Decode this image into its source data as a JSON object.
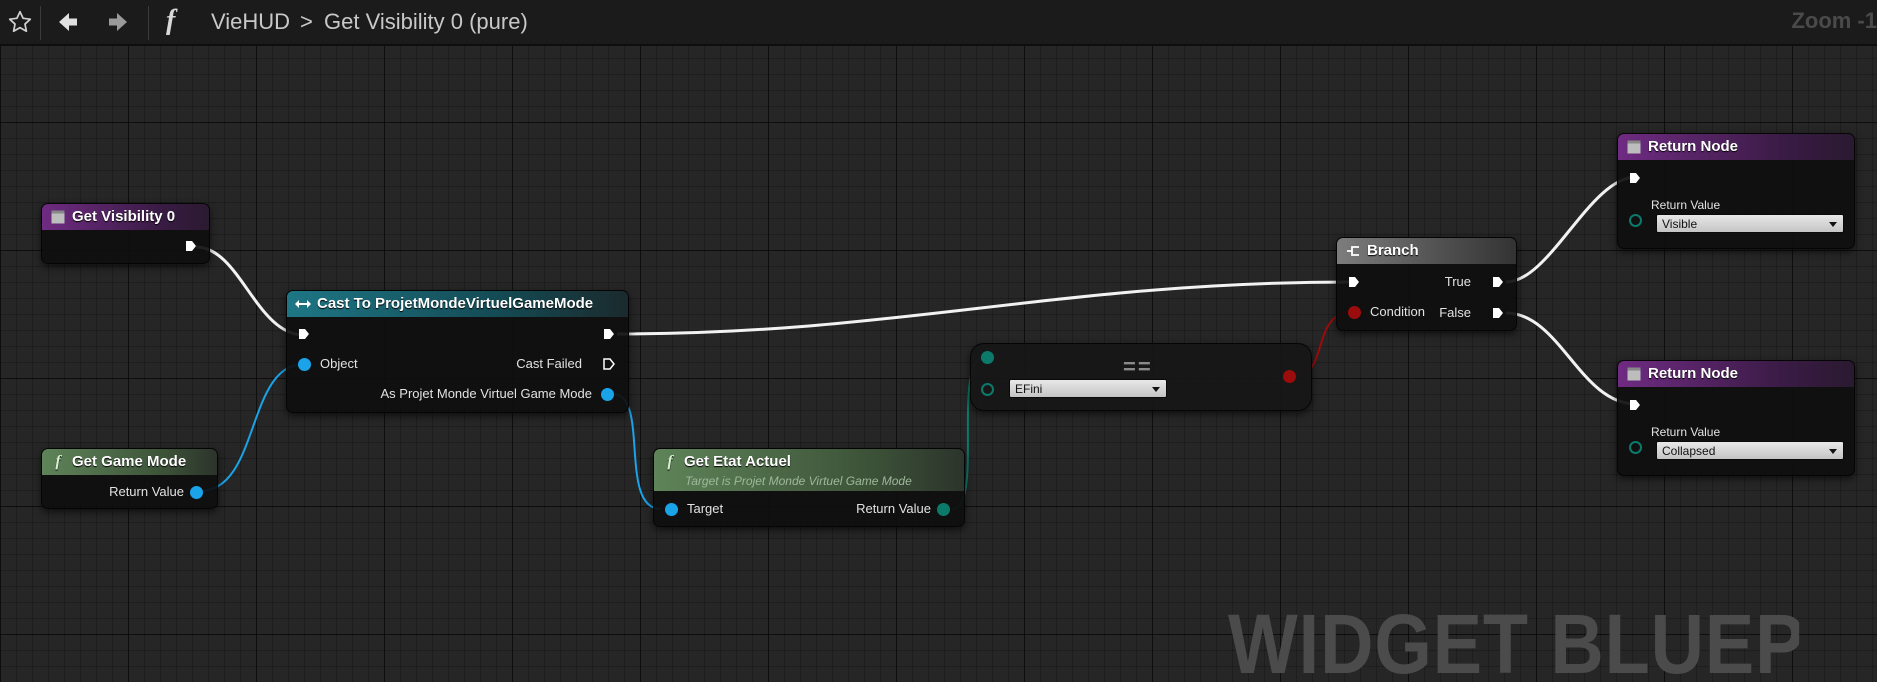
{
  "toolbar": {
    "icons": [
      "star-icon",
      "back-arrow-icon",
      "forward-arrow-icon",
      "function-icon"
    ],
    "function_symbol": "f",
    "breadcrumb_parent": "VieHUD",
    "breadcrumb_separator": ">",
    "breadcrumb_current": "Get Visibility 0 (pure)",
    "zoom_label": "Zoom -1"
  },
  "watermark": "WIDGET BLUEPRINT",
  "nodes": {
    "get_visibility": {
      "title": "Get Visibility 0"
    },
    "cast": {
      "title": "Cast To ProjetMondeVirtuelGameMode",
      "object_label": "Object",
      "cast_failed_label": "Cast Failed",
      "as_label": "As Projet Monde Virtuel Game Mode"
    },
    "get_game_mode": {
      "title": "Get Game Mode",
      "return_label": "Return Value"
    },
    "get_etat": {
      "title": "Get Etat Actuel",
      "subtitle": "Target is Projet Monde Virtuel Game Mode",
      "target_label": "Target",
      "return_label": "Return Value"
    },
    "equal": {
      "title": "==",
      "value": "EFini"
    },
    "branch": {
      "title": "Branch",
      "condition_label": "Condition",
      "true_label": "True",
      "false_label": "False"
    },
    "return_top": {
      "title": "Return Node",
      "return_label": "Return Value",
      "value": "Visible"
    },
    "return_bottom": {
      "title": "Return Node",
      "return_label": "Return Value",
      "value": "Collapsed"
    }
  },
  "colors": {
    "exec_wire": "#ffffff",
    "object_pin": "#1aa3e8",
    "enum_pin": "#0b7a6a",
    "bool_pin": "#9b0c0c"
  }
}
